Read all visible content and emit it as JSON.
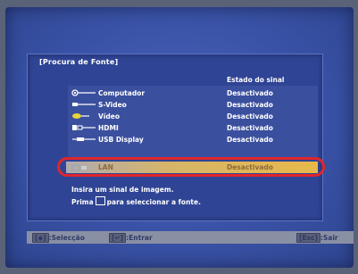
{
  "menu": {
    "title": "[Procura de Fonte]",
    "status_header": "Estado do sinal"
  },
  "sources": [
    {
      "icon": "computer-icon",
      "label": "Computador",
      "status": "Desactivado"
    },
    {
      "icon": "s-video-icon",
      "label": "S-Video",
      "status": "Desactivado"
    },
    {
      "icon": "video-icon",
      "label": "Vídeo",
      "status": "Desactivado"
    },
    {
      "icon": "hdmi-icon",
      "label": "HDMI",
      "status": "Desactivado"
    },
    {
      "icon": "usb-display-icon",
      "label": "USB Display",
      "status": "Desactivado"
    },
    {
      "icon": "lan-icon",
      "label": "LAN",
      "status": "Desactivado",
      "selected": true
    }
  ],
  "help": {
    "line1": "Insira um sinal de imagem.",
    "line2_prefix": "Prima",
    "line2_suffix": "para seleccionar a fonte."
  },
  "footer": {
    "select_key": "[◆]",
    "select_label": ":Selecção",
    "enter_key": "[↵]",
    "enter_label": ":Entrar",
    "exit_key": "[Esc]",
    "exit_label": ":Sair"
  },
  "colors": {
    "background": "#3a52a6",
    "highlight": "#e8b84a",
    "ring": "#e0262c"
  }
}
